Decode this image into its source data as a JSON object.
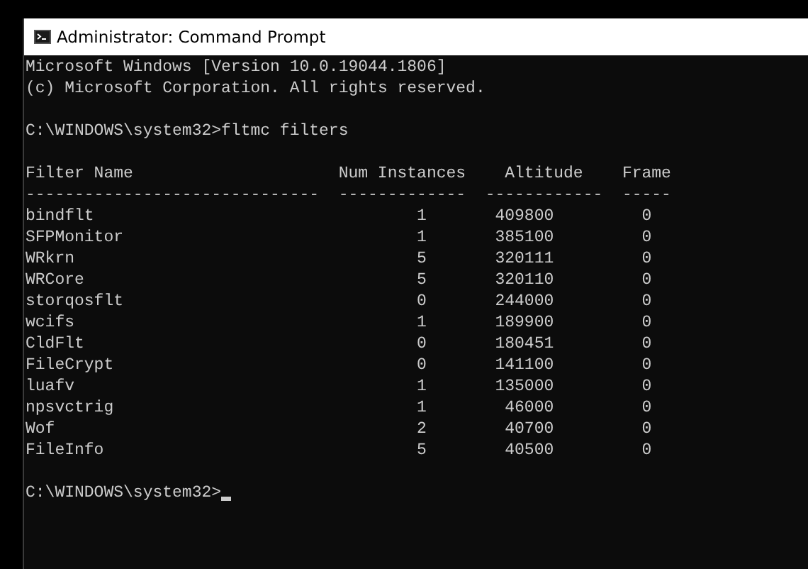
{
  "window": {
    "title": "Administrator: Command Prompt"
  },
  "console": {
    "banner": [
      "Microsoft Windows [Version 10.0.19044.1806]",
      "(c) Microsoft Corporation. All rights reserved."
    ],
    "command_line": "C:\\WINDOWS\\system32>fltmc filters",
    "table": {
      "columns": [
        "Filter Name",
        "Num Instances",
        "Altitude",
        "Frame"
      ],
      "rules": [
        "------------------------------",
        "-------------",
        "------------",
        "-----"
      ],
      "rows": [
        {
          "filter_name": "bindflt",
          "num_instances": "1",
          "altitude": "409800",
          "frame": "0"
        },
        {
          "filter_name": "SFPMonitor",
          "num_instances": "1",
          "altitude": "385100",
          "frame": "0"
        },
        {
          "filter_name": "WRkrn",
          "num_instances": "5",
          "altitude": "320111",
          "frame": "0"
        },
        {
          "filter_name": "WRCore",
          "num_instances": "5",
          "altitude": "320110",
          "frame": "0"
        },
        {
          "filter_name": "storqosflt",
          "num_instances": "0",
          "altitude": "244000",
          "frame": "0"
        },
        {
          "filter_name": "wcifs",
          "num_instances": "1",
          "altitude": "189900",
          "frame": "0"
        },
        {
          "filter_name": "CldFlt",
          "num_instances": "0",
          "altitude": "180451",
          "frame": "0"
        },
        {
          "filter_name": "FileCrypt",
          "num_instances": "0",
          "altitude": "141100",
          "frame": "0"
        },
        {
          "filter_name": "luafv",
          "num_instances": "1",
          "altitude": "135000",
          "frame": "0"
        },
        {
          "filter_name": "npsvctrig",
          "num_instances": "1",
          "altitude": "46000",
          "frame": "0"
        },
        {
          "filter_name": "Wof",
          "num_instances": "2",
          "altitude": "40700",
          "frame": "0"
        },
        {
          "filter_name": "FileInfo",
          "num_instances": "5",
          "altitude": "40500",
          "frame": "0"
        }
      ]
    },
    "prompt": "C:\\WINDOWS\\system32>"
  }
}
